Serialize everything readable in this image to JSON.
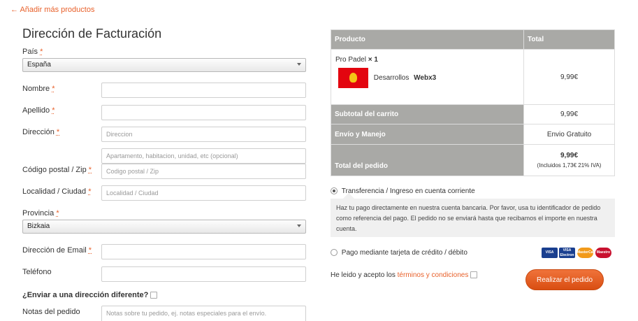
{
  "back_link": "← Añadir más productos",
  "billing": {
    "title": "Dirección de Facturación",
    "country_label": "País",
    "country_value": "España",
    "first_name_label": "Nombre",
    "last_name_label": "Apellido",
    "address_label": "Dirección",
    "address_placeholder": "Direccion",
    "address2_placeholder": "Apartamento, habitacion, unidad, etc (opcional)",
    "postcode_label": "Código postal / Zip",
    "postcode_placeholder": "Codigo postal / Zip",
    "city_label": "Localidad / Ciudad",
    "city_placeholder": "Localidad / Ciudad",
    "province_label": "Provincia",
    "province_value": "Bizkaia",
    "email_label": "Dirección de Email",
    "phone_label": "Teléfono",
    "ship_different_label": "¿Enviar a una dirección diferente?",
    "notes_label": "Notas del pedido",
    "notes_placeholder": "Notas sobre tu pedido, ej. notas especiales para el envío.",
    "required_mark": "*"
  },
  "order": {
    "col_product": "Producto",
    "col_total": "Total",
    "product_name": "Pro Padel",
    "product_qty": "× 1",
    "vendor_prefix": "Desarrollos",
    "vendor_name": "Webx3",
    "product_total": "9,99€",
    "subtotal_label": "Subtotal del carrito",
    "subtotal_value": "9,99€",
    "shipping_label": "Envío y Manejo",
    "shipping_value": "Envio Gratuito",
    "total_label": "Total del pedido",
    "total_value": "9,99€",
    "total_tax_note": "(Incluidos 1,73€ 21% IVA)"
  },
  "payment": {
    "bank_label": "Transferencia / Ingreso en cuenta corriente",
    "bank_description": "Haz tu pago directamente en nuestra cuenta bancaria. Por favor, usa tu identificador de pedido como referencia del pago. El pedido no se enviará hasta que recibamos el importe en nuestra cuenta.",
    "card_label": "Pago mediante tarjeta de crédito / débito",
    "cards": [
      "VISA",
      "VISA Electron",
      "MasterCard",
      "Maestro"
    ],
    "terms_prefix": "He leido y acepto los",
    "terms_link": "términos y condiciones",
    "place_order": "Realizar el pedido"
  },
  "colors": {
    "accent": "#e8602a",
    "table_header": "#a9a9a6"
  }
}
